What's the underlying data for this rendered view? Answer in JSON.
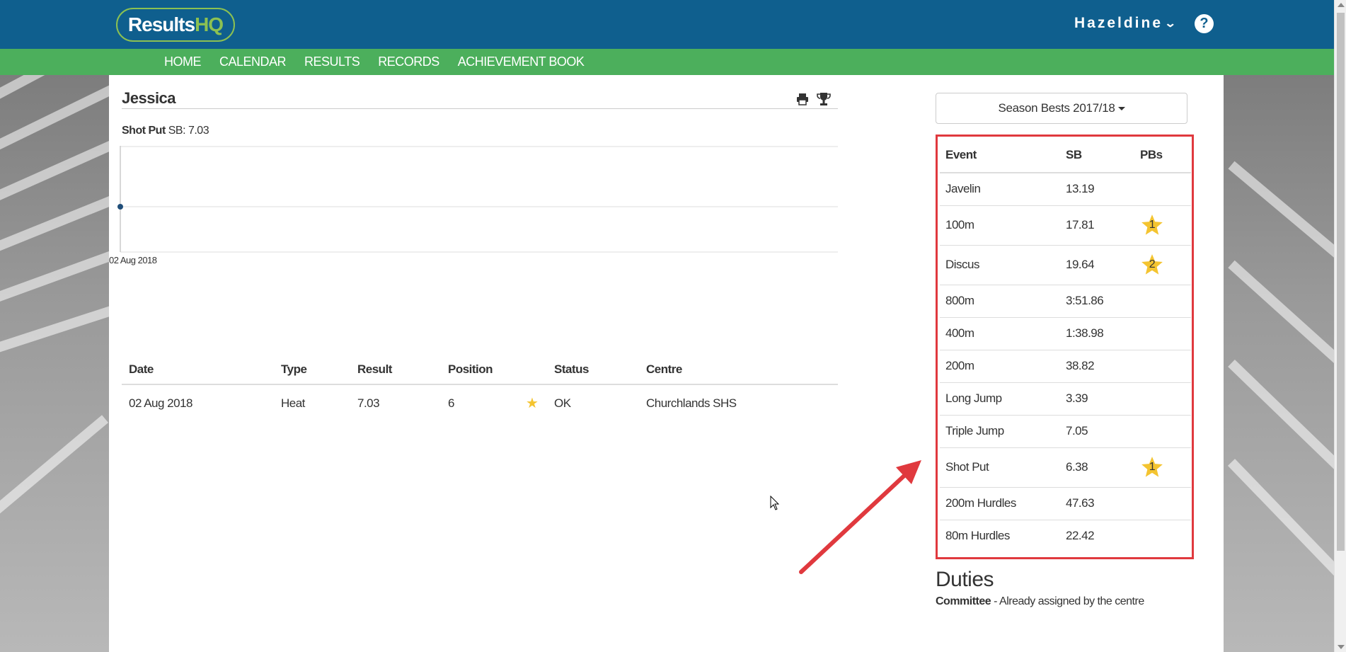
{
  "header": {
    "logo_main": "Results",
    "logo_accent": "HQ",
    "user_name": "Hazeldine",
    "help_label": "?",
    "brand_color": "#0f5f8e",
    "nav_color": "#4caf5c"
  },
  "nav": {
    "items": [
      "HOME",
      "CALENDAR",
      "RESULTS",
      "RECORDS",
      "ACHIEVEMENT BOOK"
    ]
  },
  "athlete": {
    "name": "Jessica"
  },
  "chart_caption": {
    "event": "Shot Put",
    "sb_text": "SB: 7.03"
  },
  "chart_data": {
    "type": "scatter",
    "x": [
      "02 Aug 2018"
    ],
    "values": [
      7.03
    ],
    "tick_labels": [
      "02 Aug 2018"
    ],
    "title": "",
    "xlabel": "",
    "ylabel": "",
    "grid": true
  },
  "results_table": {
    "headers": [
      "Date",
      "Type",
      "Result",
      "Position",
      "",
      "Status",
      "Centre"
    ],
    "rows": [
      [
        "02 Aug 2018",
        "Heat",
        "7.03",
        "6",
        "★",
        "OK",
        "Churchlands SHS"
      ]
    ]
  },
  "season_bests": {
    "button_label": "Season Bests 2017/18",
    "headers": [
      "Event",
      "SB",
      "PBs"
    ],
    "rows": [
      {
        "event": "Javelin",
        "sb": "13.19",
        "pb": ""
      },
      {
        "event": "100m",
        "sb": "17.81",
        "pb": "1"
      },
      {
        "event": "Discus",
        "sb": "19.64",
        "pb": "2"
      },
      {
        "event": "800m",
        "sb": "3:51.86",
        "pb": ""
      },
      {
        "event": "400m",
        "sb": "1:38.98",
        "pb": ""
      },
      {
        "event": "200m",
        "sb": "38.82",
        "pb": ""
      },
      {
        "event": "Long Jump",
        "sb": "3.39",
        "pb": ""
      },
      {
        "event": "Triple Jump",
        "sb": "7.05",
        "pb": ""
      },
      {
        "event": "Shot Put",
        "sb": "6.38",
        "pb": "1"
      },
      {
        "event": "200m Hurdles",
        "sb": "47.63",
        "pb": ""
      },
      {
        "event": "80m Hurdles",
        "sb": "22.42",
        "pb": ""
      }
    ],
    "highlight_color": "#e0393e",
    "star_color": "#f4c430"
  },
  "duties": {
    "title": "Duties",
    "role": "Committee",
    "detail": " - Already assigned by the centre"
  }
}
